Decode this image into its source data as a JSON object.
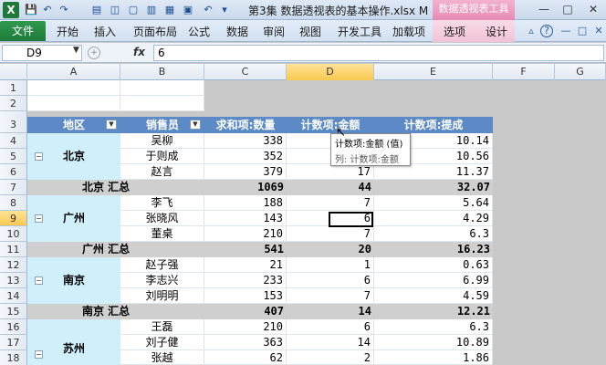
{
  "app": {
    "logo": "X",
    "doc_title": "第3集 数据透视表的基本操作.xlsx M",
    "tools_title": "数据透视表工具"
  },
  "window_controls": {
    "minimize": "—",
    "restore": "□",
    "close": "✕"
  },
  "quick_access": {
    "save": "💾",
    "undo": "↶",
    "redo": "↷",
    "more": "▾"
  },
  "ribbon": {
    "file_tab": "文件",
    "tabs": [
      "开始",
      "插入",
      "页面布局",
      "公式",
      "数据",
      "审阅",
      "视图",
      "开发工具",
      "加载项"
    ],
    "context_tabs": [
      "选项",
      "设计"
    ],
    "help": "?"
  },
  "formula_bar": {
    "name_box": "D9",
    "fx": "fx",
    "content": "6"
  },
  "columns": [
    "A",
    "B",
    "C",
    "D",
    "E",
    "F",
    "G"
  ],
  "rows": [
    "1",
    "2",
    "3",
    "4",
    "5",
    "6",
    "7",
    "8",
    "9",
    "10",
    "11",
    "12",
    "13",
    "14",
    "15",
    "16",
    "17",
    "18"
  ],
  "pivot": {
    "headers": {
      "region": "地区",
      "seller": "销售员",
      "sum_qty": "求和项:数量",
      "count_amount": "计数项:金额",
      "count_commission": "计数项:提成"
    },
    "groups": [
      {
        "region": "北京",
        "rows": [
          {
            "seller": "吴柳",
            "qty": "338",
            "count": "",
            "commission": "10.14"
          },
          {
            "seller": "于则成",
            "qty": "352",
            "count": "",
            "commission": "10.56"
          },
          {
            "seller": "赵言",
            "qty": "379",
            "count": "17",
            "commission": "11.37"
          }
        ],
        "total_label": "北京 汇总",
        "total": {
          "qty": "1069",
          "count": "44",
          "commission": "32.07"
        }
      },
      {
        "region": "广州",
        "rows": [
          {
            "seller": "李飞",
            "qty": "188",
            "count": "7",
            "commission": "5.64"
          },
          {
            "seller": "张晓风",
            "qty": "143",
            "count": "6",
            "commission": "4.29"
          },
          {
            "seller": "董桌",
            "qty": "210",
            "count": "7",
            "commission": "6.3"
          }
        ],
        "total_label": "广州 汇总",
        "total": {
          "qty": "541",
          "count": "20",
          "commission": "16.23"
        }
      },
      {
        "region": "南京",
        "rows": [
          {
            "seller": "赵子强",
            "qty": "21",
            "count": "1",
            "commission": "0.63"
          },
          {
            "seller": "李志兴",
            "qty": "233",
            "count": "6",
            "commission": "6.99"
          },
          {
            "seller": "刘明明",
            "qty": "153",
            "count": "7",
            "commission": "4.59"
          }
        ],
        "total_label": "南京 汇总",
        "total": {
          "qty": "407",
          "count": "14",
          "commission": "12.21"
        }
      },
      {
        "region": "苏州",
        "rows": [
          {
            "seller": "王磊",
            "qty": "210",
            "count": "6",
            "commission": "6.3"
          },
          {
            "seller": "刘子健",
            "qty": "363",
            "count": "14",
            "commission": "10.89"
          },
          {
            "seller": "张越",
            "qty": "62",
            "count": "2",
            "commission": "1.86"
          }
        ]
      }
    ]
  },
  "tooltip": {
    "line1": "计数项:金额 (值)",
    "line2": "列: 计数项:金额"
  },
  "collapse_symbol": "⊟",
  "dropdown_symbol": "▼",
  "cursor_symbol": "↖"
}
